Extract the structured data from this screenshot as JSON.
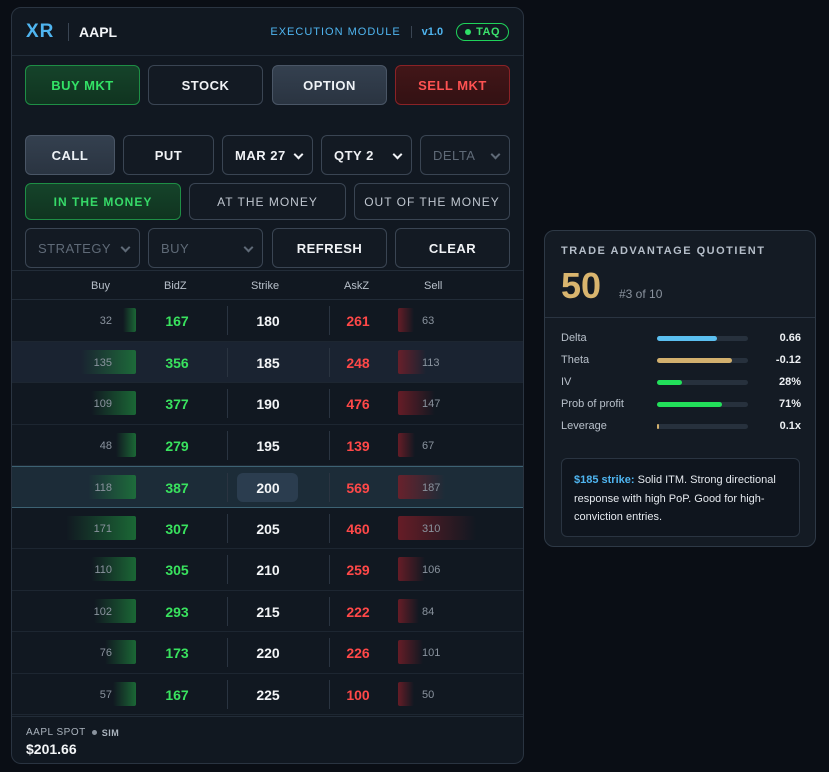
{
  "header": {
    "logo": "XR",
    "ticker": "AAPL",
    "module": "EXECUTION MODULE",
    "version": "v1.0",
    "badge": "TAQ"
  },
  "actions": {
    "buy_mkt": "BUY MKT",
    "stock": "STOCK",
    "option": "OPTION",
    "sell_mkt": "SELL MKT"
  },
  "option_controls": {
    "call": "CALL",
    "put": "PUT",
    "expiry": "MAR 27",
    "qty": "QTY 2",
    "delta": "DELTA"
  },
  "moneyness": {
    "itm": "IN THE MONEY",
    "atm": "AT THE MONEY",
    "otm": "OUT OF THE MONEY"
  },
  "tools": {
    "strategy": "STRATEGY",
    "side": "BUY",
    "refresh": "REFRESH",
    "clear": "CLEAR"
  },
  "table": {
    "headers": {
      "buy": "Buy",
      "bidz": "BidZ",
      "strike": "Strike",
      "askz": "AskZ",
      "sell": "Sell"
    },
    "rows": [
      {
        "buy": "32",
        "bidz": "167",
        "strike": "180",
        "askz": "261",
        "sell": "63"
      },
      {
        "buy": "135",
        "bidz": "356",
        "strike": "185",
        "askz": "248",
        "sell": "113"
      },
      {
        "buy": "109",
        "bidz": "377",
        "strike": "190",
        "askz": "476",
        "sell": "147"
      },
      {
        "buy": "48",
        "bidz": "279",
        "strike": "195",
        "askz": "139",
        "sell": "67"
      },
      {
        "buy": "118",
        "bidz": "387",
        "strike": "200",
        "askz": "569",
        "sell": "187"
      },
      {
        "buy": "171",
        "bidz": "307",
        "strike": "205",
        "askz": "460",
        "sell": "310"
      },
      {
        "buy": "110",
        "bidz": "305",
        "strike": "210",
        "askz": "259",
        "sell": "106"
      },
      {
        "buy": "102",
        "bidz": "293",
        "strike": "215",
        "askz": "222",
        "sell": "84"
      },
      {
        "buy": "76",
        "bidz": "173",
        "strike": "220",
        "askz": "226",
        "sell": "101"
      },
      {
        "buy": "57",
        "bidz": "167",
        "strike": "225",
        "askz": "100",
        "sell": "50"
      }
    ]
  },
  "footer": {
    "spot_label": "AAPL SPOT",
    "sim": "SIM",
    "spot_value": "$201.66"
  },
  "taq": {
    "title": "TRADE ADVANTAGE QUOTIENT",
    "score": "50",
    "rank": "#3 of 10",
    "metrics": [
      {
        "label": "Delta",
        "value": "0.66",
        "level": 0.66,
        "color": "#5bbff0"
      },
      {
        "label": "Theta",
        "value": "-0.12",
        "level": 0.82,
        "color": "#d2b06e"
      },
      {
        "label": "IV",
        "value": "28%",
        "level": 0.28,
        "color": "#22e05a"
      },
      {
        "label": "Prob of profit",
        "value": "71%",
        "level": 0.71,
        "color": "#22e05a"
      },
      {
        "label": "Leverage",
        "value": "0.1x",
        "level": 0.01,
        "color": "#d2b06e"
      }
    ],
    "note_strike": "$185 strike:",
    "note_text": " Solid ITM. Strong directional response with high PoP. Good for high-conviction entries."
  },
  "colors": {
    "accent": "#4fb5f0",
    "bid_green": "#39e25e",
    "ask_red": "#ff4848",
    "score_gold": "#d9b56e"
  }
}
